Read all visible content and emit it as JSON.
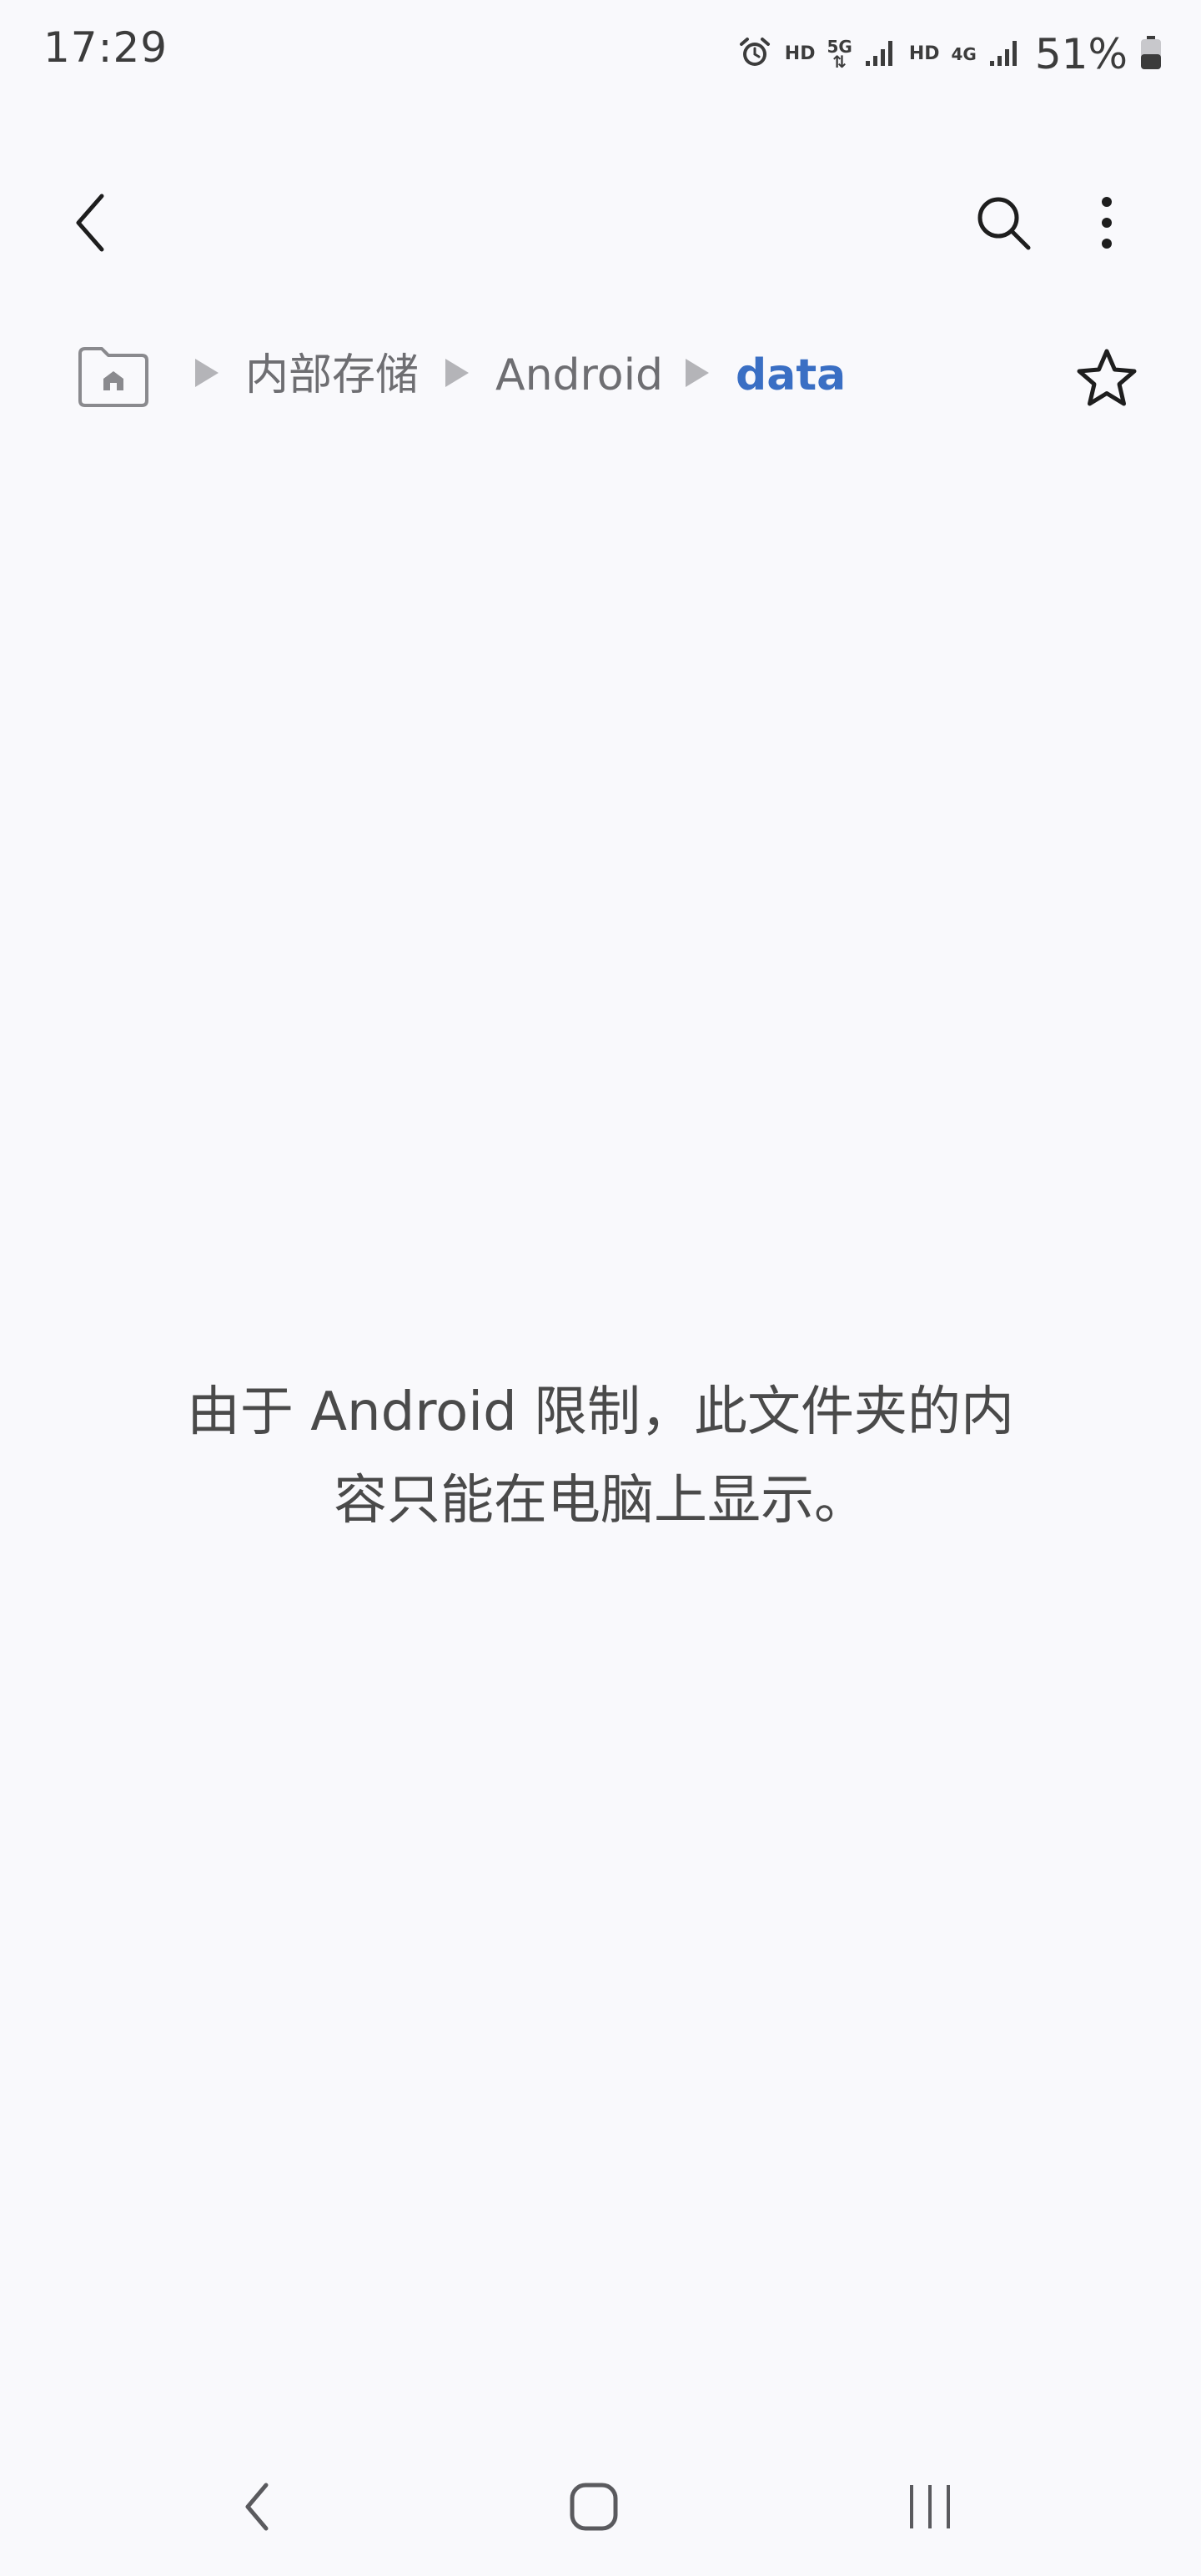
{
  "status_bar": {
    "time": "17:29",
    "hd1": "HD",
    "net1_type": "5G",
    "hd2": "HD",
    "net2_type": "4G",
    "battery_percent": "51%",
    "icons": [
      "alarm-icon",
      "signal-icon",
      "signal-icon",
      "battery-icon"
    ]
  },
  "app_bar": {
    "icons": [
      "back-arrow-icon",
      "search-icon",
      "more-vert-icon"
    ]
  },
  "breadcrumb": {
    "home_icon": "home-folder-icon",
    "items": [
      {
        "label": "内部存储"
      },
      {
        "label": "Android"
      },
      {
        "label": "data"
      }
    ],
    "favorite_icon": "star-outline-icon",
    "current_color": "#3a6fc4"
  },
  "message": {
    "line1": "由于 Android 限制，此文件夹的内",
    "line2": "容只能在电脑上显示。"
  },
  "nav_bar": {
    "icons": [
      "nav-back-icon",
      "nav-home-icon",
      "nav-recents-icon"
    ]
  }
}
